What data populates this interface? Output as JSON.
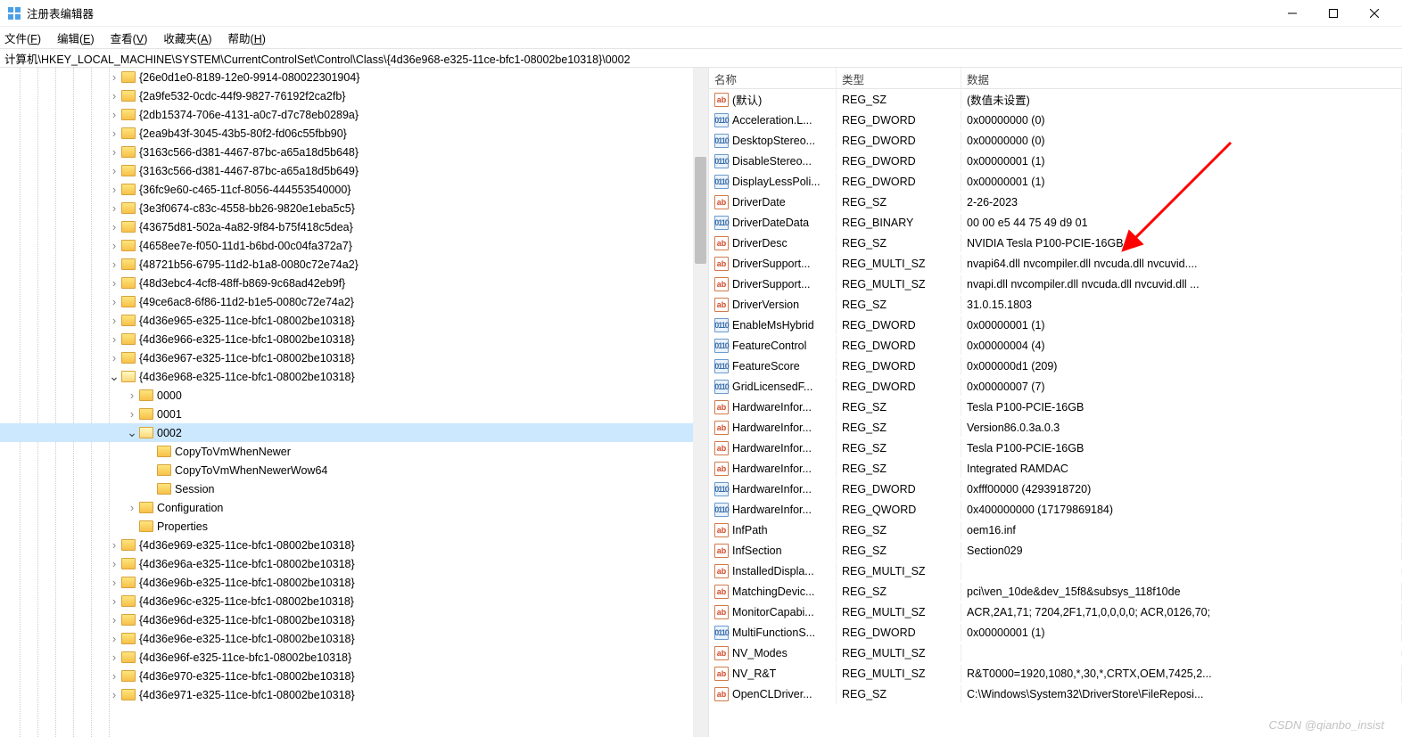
{
  "window": {
    "title": "注册表编辑器",
    "minimize_label": "—",
    "maximize_label": "▢",
    "close_label": "✕"
  },
  "menu": {
    "file": "文件(F)",
    "edit": "编辑(E)",
    "view": "查看(V)",
    "favorites": "收藏夹(A)",
    "help": "帮助(H)"
  },
  "address_path": "计算机\\HKEY_LOCAL_MACHINE\\SYSTEM\\CurrentControlSet\\Control\\Class\\{4d36e968-e325-11ce-bfc1-08002be10318}\\0002",
  "tree": [
    {
      "indent": 6,
      "chevron": ">",
      "name": "{26e0d1e0-8189-12e0-9914-080022301904}"
    },
    {
      "indent": 6,
      "chevron": ">",
      "name": "{2a9fe532-0cdc-44f9-9827-76192f2ca2fb}"
    },
    {
      "indent": 6,
      "chevron": ">",
      "name": "{2db15374-706e-4131-a0c7-d7c78eb0289a}"
    },
    {
      "indent": 6,
      "chevron": ">",
      "name": "{2ea9b43f-3045-43b5-80f2-fd06c55fbb90}"
    },
    {
      "indent": 6,
      "chevron": ">",
      "name": "{3163c566-d381-4467-87bc-a65a18d5b648}"
    },
    {
      "indent": 6,
      "chevron": ">",
      "name": "{3163c566-d381-4467-87bc-a65a18d5b649}"
    },
    {
      "indent": 6,
      "chevron": ">",
      "name": "{36fc9e60-c465-11cf-8056-444553540000}"
    },
    {
      "indent": 6,
      "chevron": ">",
      "name": "{3e3f0674-c83c-4558-bb26-9820e1eba5c5}"
    },
    {
      "indent": 6,
      "chevron": ">",
      "name": "{43675d81-502a-4a82-9f84-b75f418c5dea}"
    },
    {
      "indent": 6,
      "chevron": ">",
      "name": "{4658ee7e-f050-11d1-b6bd-00c04fa372a7}"
    },
    {
      "indent": 6,
      "chevron": ">",
      "name": "{48721b56-6795-11d2-b1a8-0080c72e74a2}"
    },
    {
      "indent": 6,
      "chevron": ">",
      "name": "{48d3ebc4-4cf8-48ff-b869-9c68ad42eb9f}"
    },
    {
      "indent": 6,
      "chevron": ">",
      "name": "{49ce6ac8-6f86-11d2-b1e5-0080c72e74a2}"
    },
    {
      "indent": 6,
      "chevron": ">",
      "name": "{4d36e965-e325-11ce-bfc1-08002be10318}"
    },
    {
      "indent": 6,
      "chevron": ">",
      "name": "{4d36e966-e325-11ce-bfc1-08002be10318}"
    },
    {
      "indent": 6,
      "chevron": ">",
      "name": "{4d36e967-e325-11ce-bfc1-08002be10318}"
    },
    {
      "indent": 6,
      "chevron": "v",
      "name": "{4d36e968-e325-11ce-bfc1-08002be10318}",
      "open": true
    },
    {
      "indent": 7,
      "chevron": ">",
      "name": "0000"
    },
    {
      "indent": 7,
      "chevron": ">",
      "name": "0001"
    },
    {
      "indent": 7,
      "chevron": "v",
      "name": "0002",
      "open": true,
      "selected": true
    },
    {
      "indent": 8,
      "chevron": "",
      "name": "CopyToVmWhenNewer"
    },
    {
      "indent": 8,
      "chevron": "",
      "name": "CopyToVmWhenNewerWow64"
    },
    {
      "indent": 8,
      "chevron": "",
      "name": "Session"
    },
    {
      "indent": 7,
      "chevron": ">",
      "name": "Configuration"
    },
    {
      "indent": 7,
      "chevron": "",
      "name": "Properties"
    },
    {
      "indent": 6,
      "chevron": ">",
      "name": "{4d36e969-e325-11ce-bfc1-08002be10318}"
    },
    {
      "indent": 6,
      "chevron": ">",
      "name": "{4d36e96a-e325-11ce-bfc1-08002be10318}"
    },
    {
      "indent": 6,
      "chevron": ">",
      "name": "{4d36e96b-e325-11ce-bfc1-08002be10318}"
    },
    {
      "indent": 6,
      "chevron": ">",
      "name": "{4d36e96c-e325-11ce-bfc1-08002be10318}"
    },
    {
      "indent": 6,
      "chevron": ">",
      "name": "{4d36e96d-e325-11ce-bfc1-08002be10318}"
    },
    {
      "indent": 6,
      "chevron": ">",
      "name": "{4d36e96e-e325-11ce-bfc1-08002be10318}"
    },
    {
      "indent": 6,
      "chevron": ">",
      "name": "{4d36e96f-e325-11ce-bfc1-08002be10318}"
    },
    {
      "indent": 6,
      "chevron": ">",
      "name": "{4d36e970-e325-11ce-bfc1-08002be10318}"
    },
    {
      "indent": 6,
      "chevron": ">",
      "name": "{4d36e971-e325-11ce-bfc1-08002be10318}"
    }
  ],
  "list_header": {
    "name": "名称",
    "type": "类型",
    "data": "数据"
  },
  "values": [
    {
      "icon": "str",
      "name": "(默认)",
      "type": "REG_SZ",
      "data": "(数值未设置)"
    },
    {
      "icon": "bin",
      "name": "Acceleration.L...",
      "type": "REG_DWORD",
      "data": "0x00000000 (0)"
    },
    {
      "icon": "bin",
      "name": "DesktopStereo...",
      "type": "REG_DWORD",
      "data": "0x00000000 (0)"
    },
    {
      "icon": "bin",
      "name": "DisableStereo...",
      "type": "REG_DWORD",
      "data": "0x00000001 (1)"
    },
    {
      "icon": "bin",
      "name": "DisplayLessPoli...",
      "type": "REG_DWORD",
      "data": "0x00000001 (1)"
    },
    {
      "icon": "str",
      "name": "DriverDate",
      "type": "REG_SZ",
      "data": "2-26-2023"
    },
    {
      "icon": "bin",
      "name": "DriverDateData",
      "type": "REG_BINARY",
      "data": "00 00 e5 44 75 49 d9 01"
    },
    {
      "icon": "str",
      "name": "DriverDesc",
      "type": "REG_SZ",
      "data": "NVIDIA Tesla P100-PCIE-16GB"
    },
    {
      "icon": "str",
      "name": "DriverSupport...",
      "type": "REG_MULTI_SZ",
      "data": "nvapi64.dll nvcompiler.dll nvcuda.dll nvcuvid...."
    },
    {
      "icon": "str",
      "name": "DriverSupport...",
      "type": "REG_MULTI_SZ",
      "data": "nvapi.dll nvcompiler.dll nvcuda.dll nvcuvid.dll ..."
    },
    {
      "icon": "str",
      "name": "DriverVersion",
      "type": "REG_SZ",
      "data": "31.0.15.1803"
    },
    {
      "icon": "bin",
      "name": "EnableMsHybrid",
      "type": "REG_DWORD",
      "data": "0x00000001 (1)"
    },
    {
      "icon": "bin",
      "name": "FeatureControl",
      "type": "REG_DWORD",
      "data": "0x00000004 (4)"
    },
    {
      "icon": "bin",
      "name": "FeatureScore",
      "type": "REG_DWORD",
      "data": "0x000000d1 (209)"
    },
    {
      "icon": "bin",
      "name": "GridLicensedF...",
      "type": "REG_DWORD",
      "data": "0x00000007 (7)"
    },
    {
      "icon": "str",
      "name": "HardwareInfor...",
      "type": "REG_SZ",
      "data": "Tesla P100-PCIE-16GB"
    },
    {
      "icon": "str",
      "name": "HardwareInfor...",
      "type": "REG_SZ",
      "data": "Version86.0.3a.0.3"
    },
    {
      "icon": "str",
      "name": "HardwareInfor...",
      "type": "REG_SZ",
      "data": "Tesla P100-PCIE-16GB"
    },
    {
      "icon": "str",
      "name": "HardwareInfor...",
      "type": "REG_SZ",
      "data": "Integrated RAMDAC"
    },
    {
      "icon": "bin",
      "name": "HardwareInfor...",
      "type": "REG_DWORD",
      "data": "0xfff00000 (4293918720)"
    },
    {
      "icon": "bin",
      "name": "HardwareInfor...",
      "type": "REG_QWORD",
      "data": "0x400000000 (17179869184)"
    },
    {
      "icon": "str",
      "name": "InfPath",
      "type": "REG_SZ",
      "data": "oem16.inf"
    },
    {
      "icon": "str",
      "name": "InfSection",
      "type": "REG_SZ",
      "data": "Section029"
    },
    {
      "icon": "str",
      "name": "InstalledDispla...",
      "type": "REG_MULTI_SZ",
      "data": ""
    },
    {
      "icon": "str",
      "name": "MatchingDevic...",
      "type": "REG_SZ",
      "data": "pci\\ven_10de&dev_15f8&subsys_118f10de"
    },
    {
      "icon": "str",
      "name": "MonitorCapabi...",
      "type": "REG_MULTI_SZ",
      "data": "ACR,2A1,71; 7204,2F1,71,0,0,0,0; ACR,0126,70;"
    },
    {
      "icon": "bin",
      "name": "MultiFunctionS...",
      "type": "REG_DWORD",
      "data": "0x00000001 (1)"
    },
    {
      "icon": "str",
      "name": "NV_Modes",
      "type": "REG_MULTI_SZ",
      "data": ""
    },
    {
      "icon": "str",
      "name": "NV_R&T",
      "type": "REG_MULTI_SZ",
      "data": "R&T0000=1920,1080,*,30,*,CRTX,OEM,7425,2..."
    },
    {
      "icon": "str",
      "name": "OpenCLDriver...",
      "type": "REG_SZ",
      "data": "C:\\Windows\\System32\\DriverStore\\FileReposi..."
    }
  ],
  "watermark": "CSDN @qianbo_insist"
}
